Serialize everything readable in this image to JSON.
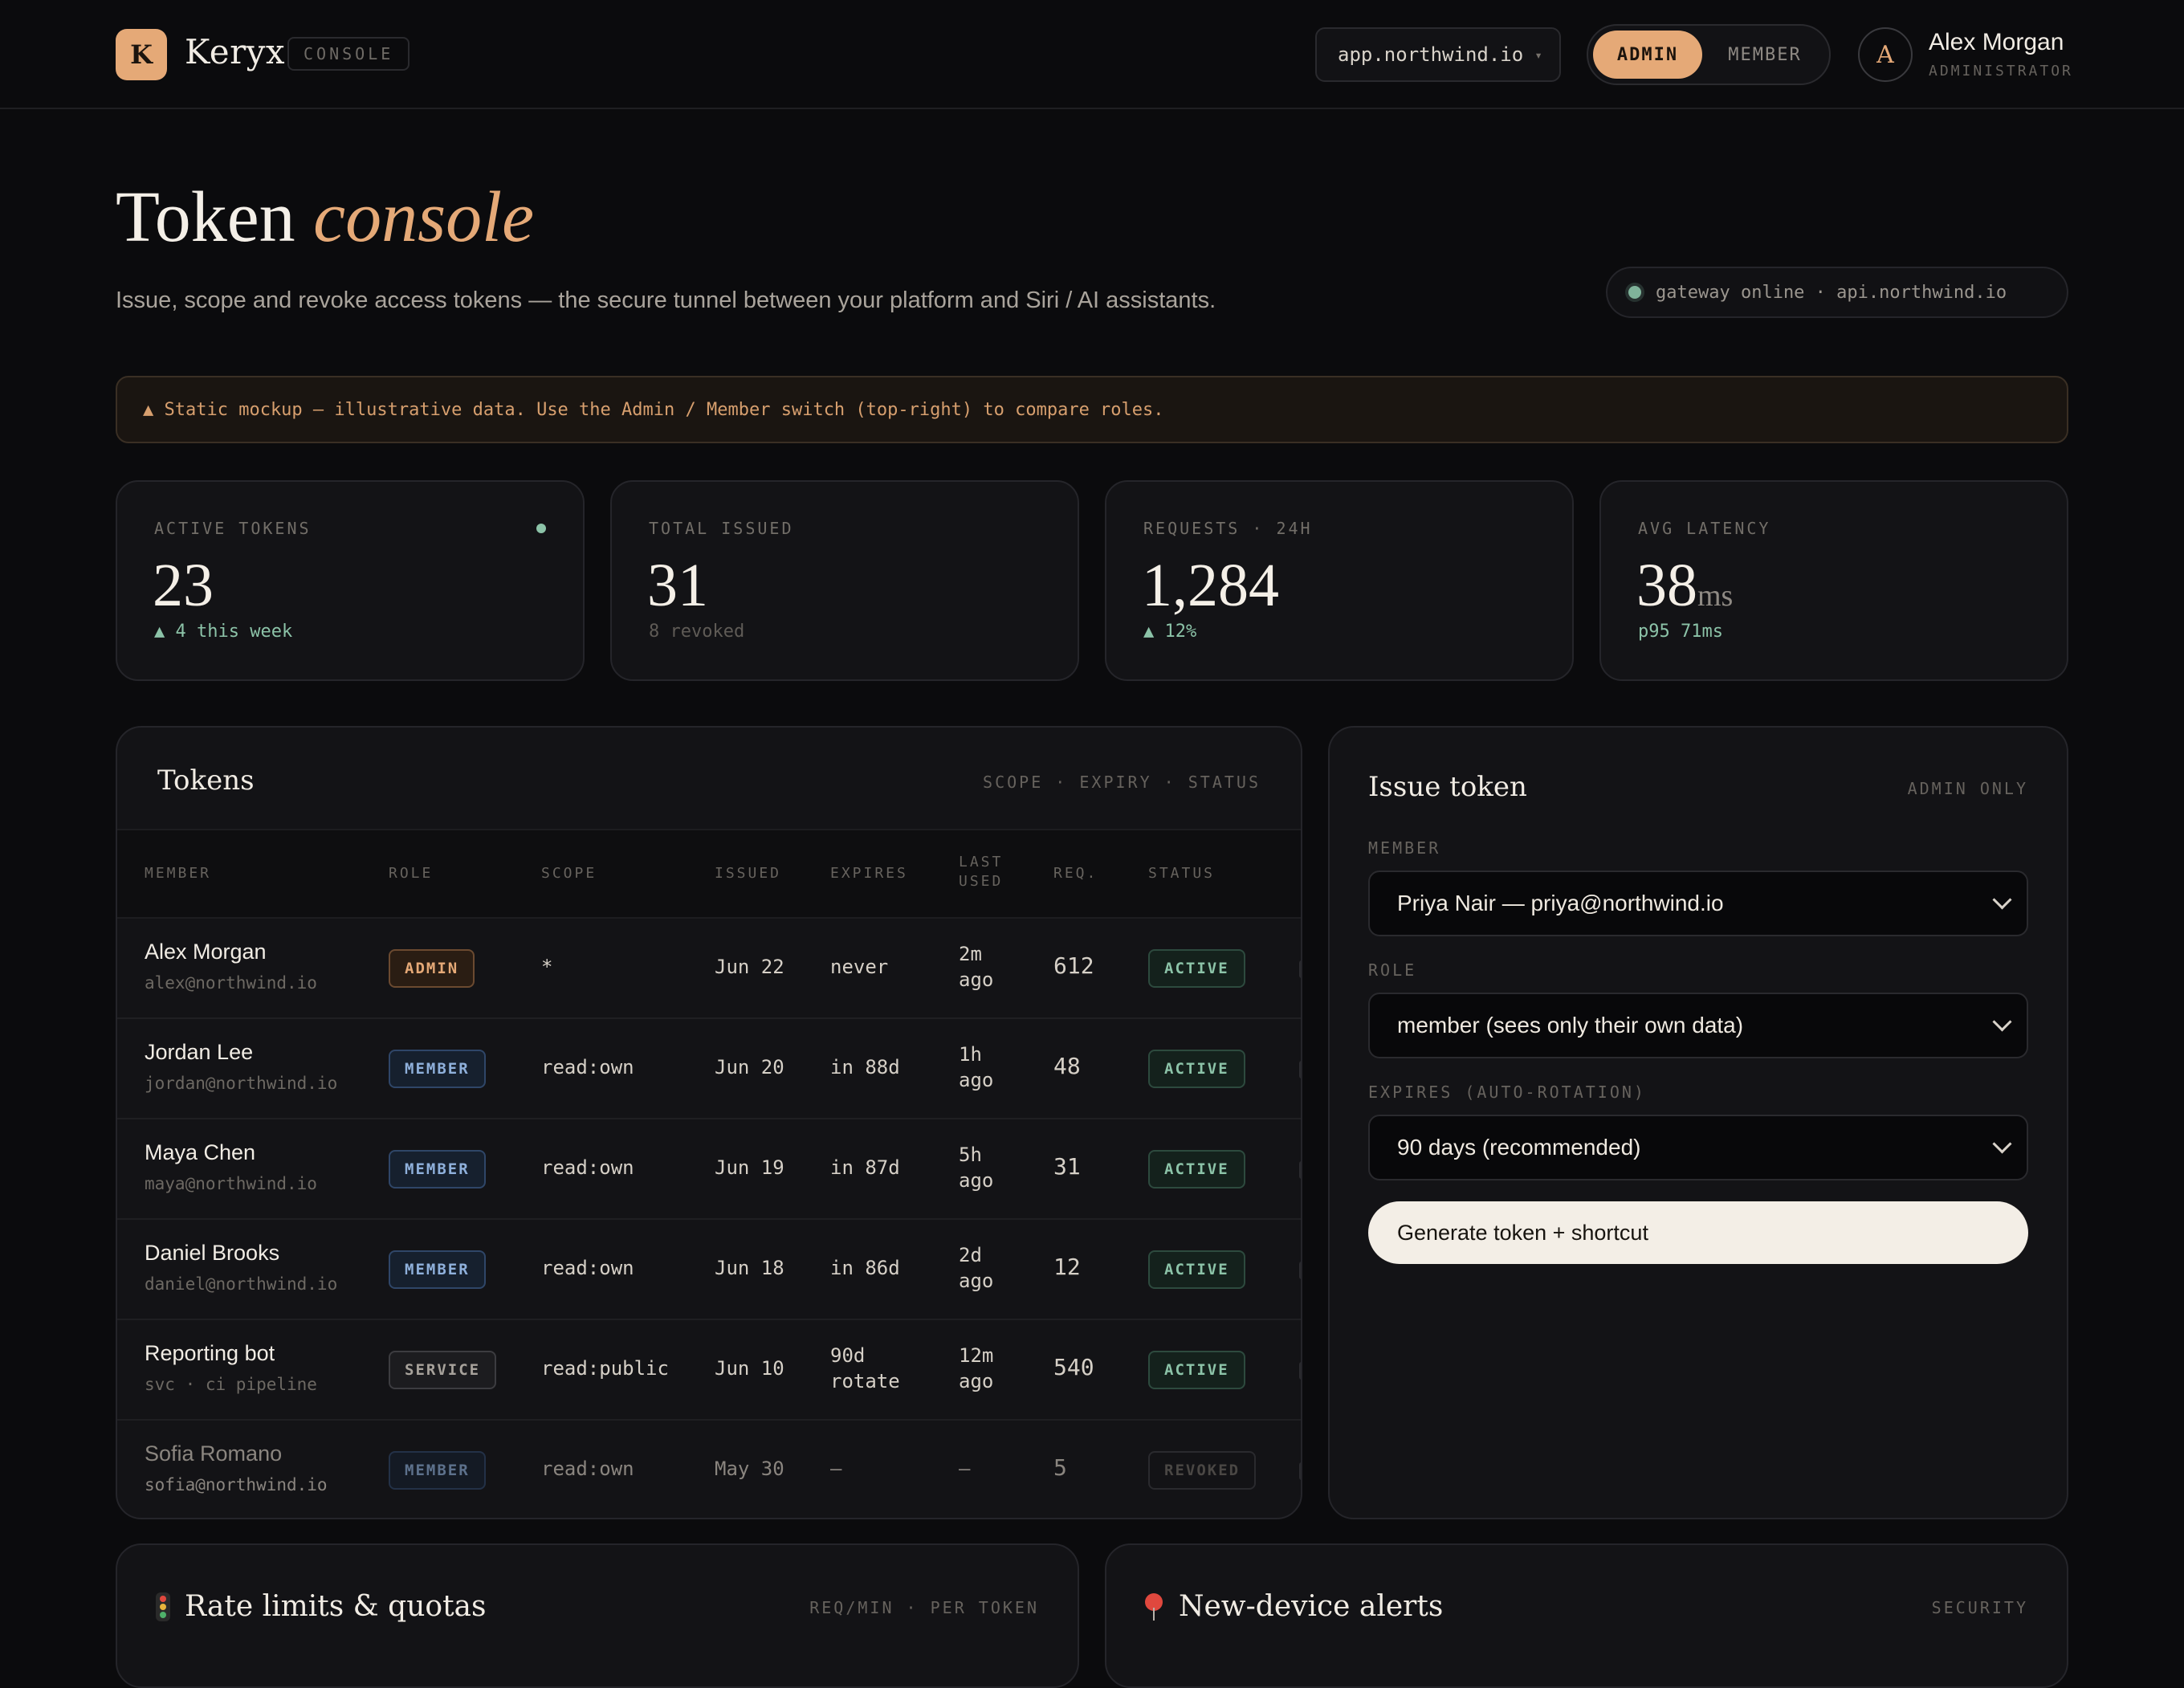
{
  "header": {
    "brand_initial": "K",
    "brand_name": "Keryx",
    "brand_badge": "CONSOLE",
    "workspace": "app.northwind.io",
    "workspace_chevron": "▾",
    "role_switch": {
      "active": "ADMIN",
      "inactive": "MEMBER"
    },
    "user": {
      "initial": "A",
      "name": "Alex Morgan",
      "role": "ADMINISTRATOR"
    }
  },
  "hero": {
    "title": "Token",
    "title_accent": "console",
    "subtitle": "Issue, scope and revoke access tokens — the secure tunnel between your platform and Siri / AI assistants.",
    "gateway_status": "gateway online · api.northwind.io"
  },
  "notice": "▲ Static mockup — illustrative data. Use the Admin / Member switch (top-right) to compare roles.",
  "stats": [
    {
      "label": "ACTIVE TOKENS",
      "value": "23",
      "unit": "",
      "foot": "▲ 4 this week",
      "foot_color": "#8cc3a8"
    },
    {
      "label": "TOTAL ISSUED",
      "value": "31",
      "unit": "",
      "foot": "8 revoked",
      "foot_color": "#5f5b56"
    },
    {
      "label": "REQUESTS · 24H",
      "value": "1,284",
      "unit": "",
      "foot": "▲ 12%",
      "foot_color": "#8cc3a8"
    },
    {
      "label": "AVG LATENCY",
      "value": "38",
      "unit": "ms",
      "foot": "p95 71ms",
      "foot_color": "#8cc3a8"
    }
  ],
  "tokens": {
    "title": "Tokens",
    "meta": "SCOPE · EXPIRY · STATUS",
    "columns": [
      "MEMBER",
      "ROLE",
      "SCOPE",
      "ISSUED",
      "EXPIRES",
      "LAST USED",
      "REQ.",
      "STATUS"
    ],
    "rows": [
      {
        "name": "Alex Morgan",
        "email": "alex@northwind.io",
        "role": "ADMIN",
        "scope": "*",
        "issued": "Jun 22",
        "expires": "never",
        "last_used": "2m ago",
        "req": "612",
        "status": "ACTIVE"
      },
      {
        "name": "Jordan Lee",
        "email": "jordan@northwind.io",
        "role": "MEMBER",
        "scope": "read:own",
        "issued": "Jun 20",
        "expires": "in 88d",
        "last_used": "1h ago",
        "req": "48",
        "status": "ACTIVE"
      },
      {
        "name": "Maya Chen",
        "email": "maya@northwind.io",
        "role": "MEMBER",
        "scope": "read:own",
        "issued": "Jun 19",
        "expires": "in 87d",
        "last_used": "5h ago",
        "req": "31",
        "status": "ACTIVE"
      },
      {
        "name": "Daniel Brooks",
        "email": "daniel@northwind.io",
        "role": "MEMBER",
        "scope": "read:own",
        "issued": "Jun 18",
        "expires": "in 86d",
        "last_used": "2d ago",
        "req": "12",
        "status": "ACTIVE"
      },
      {
        "name": "Reporting bot",
        "email": "svc · ci pipeline",
        "role": "SERVICE",
        "scope": "read:public",
        "issued": "Jun 10",
        "expires": "90d rotate",
        "last_used": "12m ago",
        "req": "540",
        "status": "ACTIVE"
      },
      {
        "name": "Sofia Romano",
        "email": "sofia@northwind.io",
        "role": "MEMBER",
        "scope": "read:own",
        "issued": "May 30",
        "expires": "—",
        "last_used": "—",
        "req": "5",
        "status": "REVOKED"
      }
    ]
  },
  "issue": {
    "title": "Issue token",
    "meta": "ADMIN ONLY",
    "member_label": "MEMBER",
    "member_value": "Priya Nair — priya@northwind.io",
    "role_label": "ROLE",
    "role_value": "member (sees only their own data)",
    "expires_label": "EXPIRES (AUTO-ROTATION)",
    "expires_value": "90 days (recommended)",
    "button": "Generate token + shortcut"
  },
  "rate_limits": {
    "title": "Rate limits & quotas",
    "meta": "REQ/MIN · PER TOKEN"
  },
  "alerts": {
    "title": "New-device alerts",
    "meta": "SECURITY"
  },
  "colors": {
    "accent": "#e5a977",
    "success": "#8cc3a8",
    "background": "#0b0b0d"
  }
}
